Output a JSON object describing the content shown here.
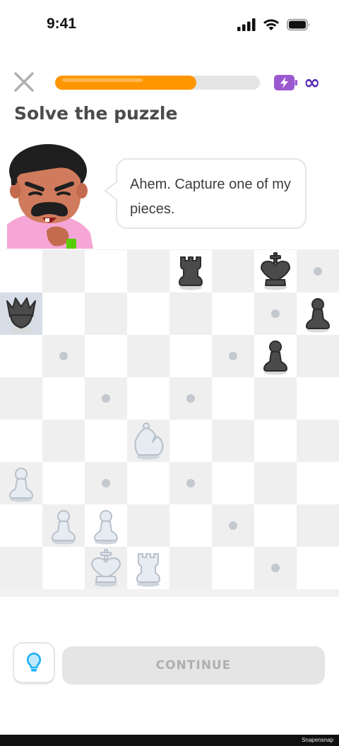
{
  "status_bar": {
    "time": "9:41",
    "icons": [
      "signal-icon",
      "wifi-icon",
      "battery-icon"
    ]
  },
  "header": {
    "close_icon": "close-icon",
    "progress_fraction": 0.69,
    "energy_icon": "energy-battery-icon",
    "energy_value": "∞"
  },
  "title": "Solve the puzzle",
  "speech_bubble": {
    "text": "Ahem. Capture one of my pieces."
  },
  "board": {
    "files": [
      "a",
      "b",
      "c",
      "d",
      "e",
      "f",
      "g",
      "h"
    ],
    "highlighted_squares": [
      "a7"
    ],
    "move_dots": [
      "h8",
      "g7",
      "b6",
      "f6",
      "c5",
      "e5",
      "c3",
      "e3",
      "f2",
      "g1"
    ],
    "pieces": [
      {
        "square": "e8",
        "piece": "rook",
        "color": "black"
      },
      {
        "square": "g8",
        "piece": "king",
        "color": "black"
      },
      {
        "square": "a7",
        "piece": "queen",
        "color": "black"
      },
      {
        "square": "h7",
        "piece": "pawn",
        "color": "black"
      },
      {
        "square": "g6",
        "piece": "pawn",
        "color": "black"
      },
      {
        "square": "d4",
        "piece": "knight",
        "color": "white"
      },
      {
        "square": "a3",
        "piece": "pawn",
        "color": "white"
      },
      {
        "square": "b2",
        "piece": "pawn",
        "color": "white"
      },
      {
        "square": "c2",
        "piece": "pawn",
        "color": "white"
      },
      {
        "square": "c1",
        "piece": "king",
        "color": "white"
      },
      {
        "square": "d1",
        "piece": "rook",
        "color": "white"
      }
    ]
  },
  "footer": {
    "hint_icon": "lightbulb-icon",
    "continue_label": "CONTINUE",
    "watermark": "Snapensnap"
  },
  "colors": {
    "progress": "#ff9600",
    "energy": "#9b59d0",
    "infinity": "#5b2bb5",
    "hint": "#1cb0f6",
    "black_piece": "#4b4b4b",
    "white_piece": "#e6ecf2"
  }
}
